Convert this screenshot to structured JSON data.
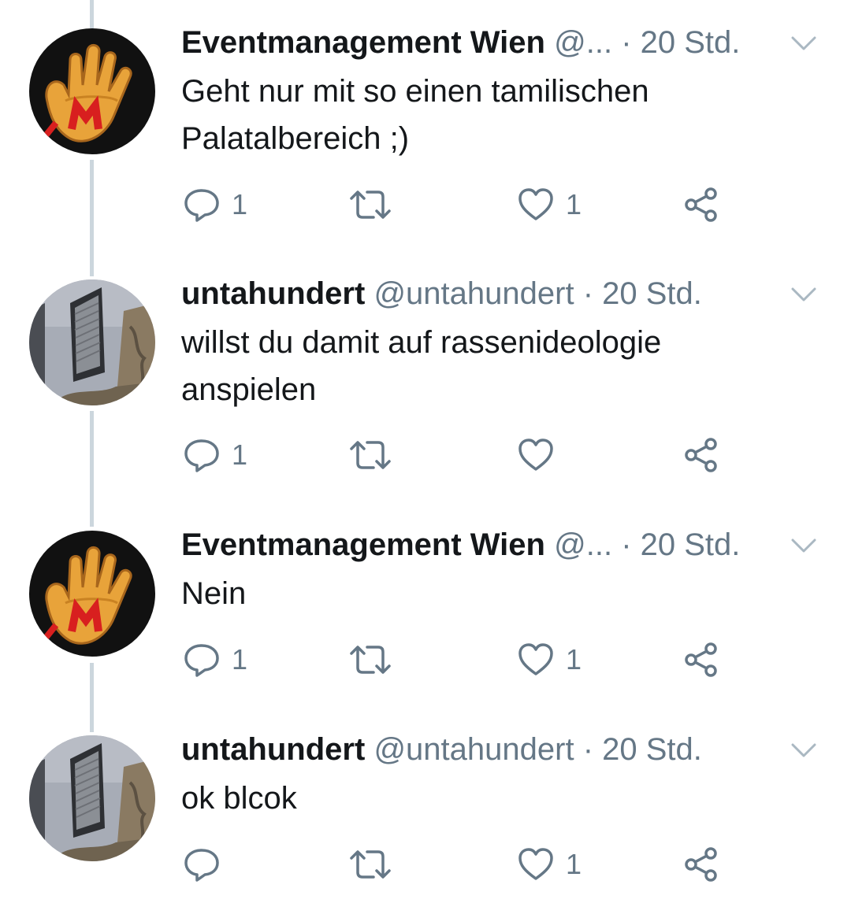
{
  "colors": {
    "text": "#14171a",
    "secondary": "#657786",
    "thread_line": "#ccd6dd",
    "icon": "#657786"
  },
  "tweets": [
    {
      "name": "Eventmanagement Wien",
      "handle": "@...",
      "dot": "·",
      "time": "20 Std.",
      "text": "Geht nur mit so einen tamilischen\nPalatalbereich ;)",
      "reply_count": "1",
      "retweet_count": "",
      "like_count": "1",
      "avatar_icon": "red-m-hand-avatar"
    },
    {
      "name": "untahundert",
      "handle": "@untahundert",
      "dot": "·",
      "time": "20 Std.",
      "text": "willst du damit auf rassenideologie\nanspielen",
      "reply_count": "1",
      "retweet_count": "",
      "like_count": "",
      "avatar_icon": "building-window-avatar"
    },
    {
      "name": "Eventmanagement Wien",
      "handle": "@...",
      "dot": "·",
      "time": "20 Std.",
      "text": "Nein",
      "reply_count": "1",
      "retweet_count": "",
      "like_count": "1",
      "avatar_icon": "red-m-hand-avatar"
    },
    {
      "name": "untahundert",
      "handle": "@untahundert",
      "dot": "·",
      "time": "20 Std.",
      "text": "ok blcok",
      "reply_count": "",
      "retweet_count": "",
      "like_count": "1",
      "avatar_icon": "building-window-avatar"
    }
  ]
}
